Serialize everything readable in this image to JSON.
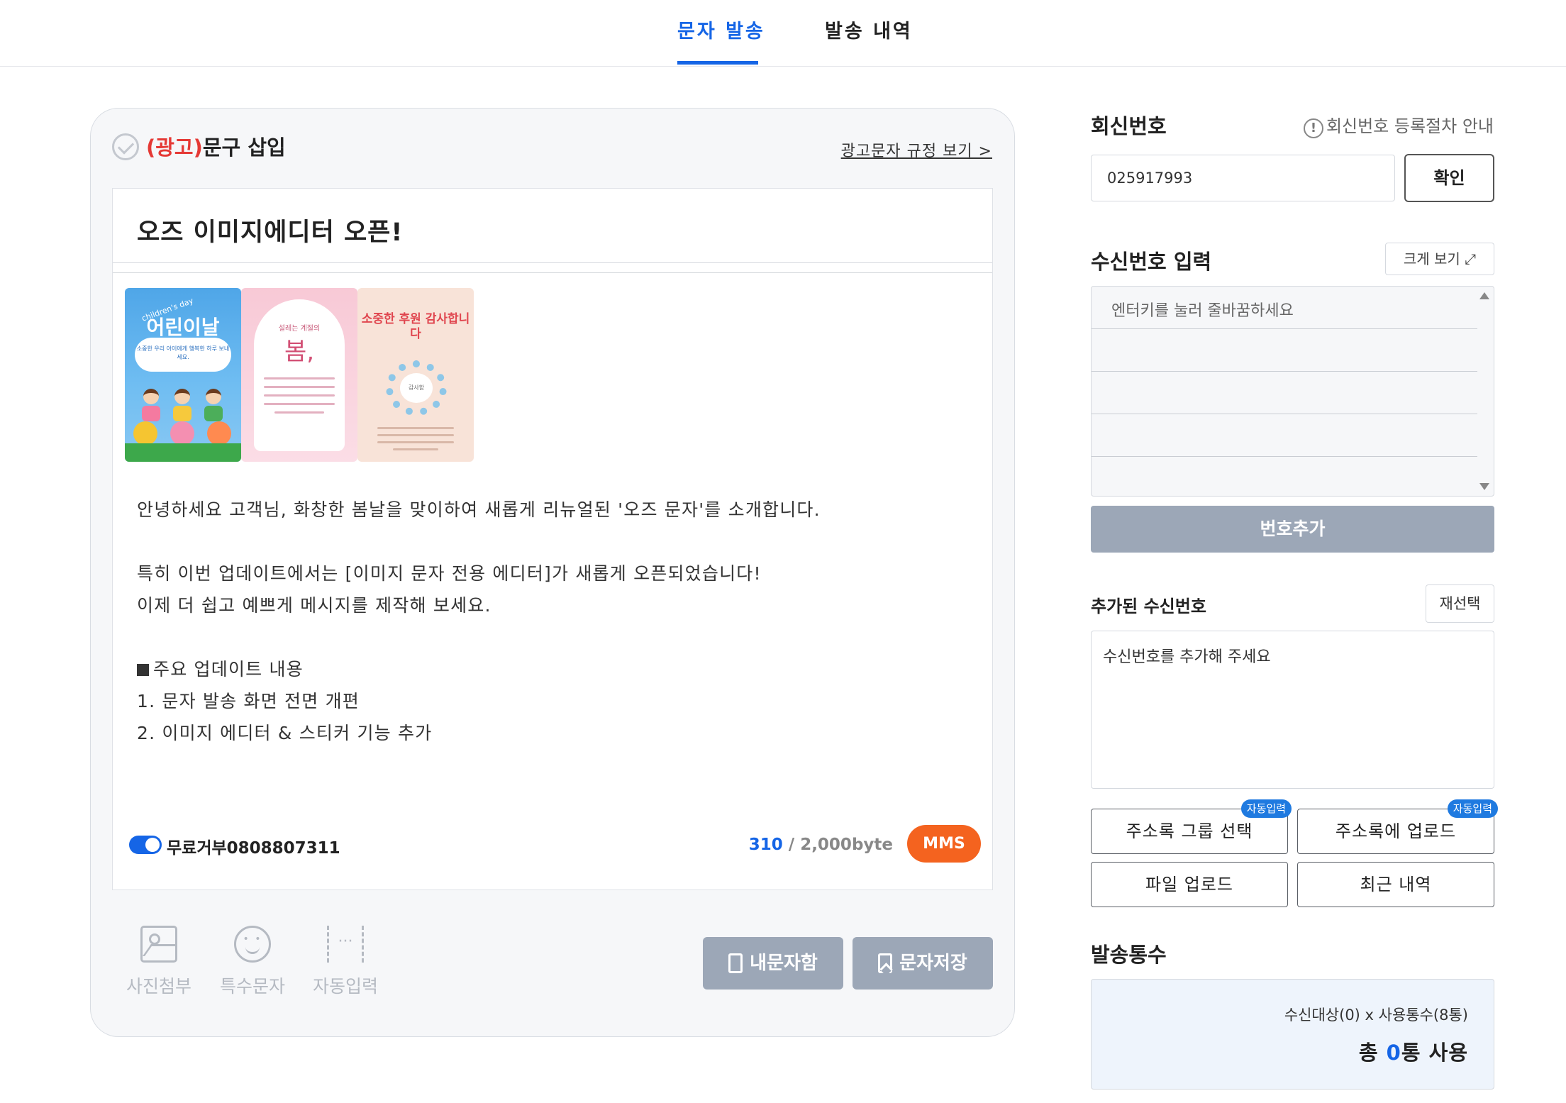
{
  "tabs": [
    {
      "label": "문자 발송",
      "active": true
    },
    {
      "label": "발송 내역",
      "active": false
    }
  ],
  "editor": {
    "ad_prefix": "(광고)",
    "ad_title_suffix": "문구 삽입",
    "ad_rule_link": "광고문자 규정 보기 >",
    "subject": "오즈 이미지에디터 오픈!",
    "images": [
      {
        "title": "어린이날",
        "subtitle": "children's day",
        "caption": "소중한 우리 아이에게 행복한 하루 보내세요."
      },
      {
        "small": "설레는 계절의",
        "big": "봄,"
      },
      {
        "title": "소중한 후원 감사합니다",
        "center": "감사함"
      }
    ],
    "body_lines": [
      "안녕하세요 고객님, 화창한 봄날을 맞이하여 새롭게 리뉴얼된 '오즈 문자'를 소개합니다.",
      "",
      "특히 이번 업데이트에서는 [이미지 문자 전용 에디터]가 새롭게 오픈되었습니다!",
      "이제 더 쉽고 예쁘게 메시지를 제작해 보세요.",
      "",
      "주요 업데이트 내용",
      "1. 문자 발송 화면 전면 개편",
      "2. 이미지 에디터 & 스티커 기능 추가"
    ],
    "optout_label": "무료거부0808807311",
    "optout_enabled": true,
    "byte_count": "310",
    "byte_limit": "/ 2,000byte",
    "message_type": "MMS"
  },
  "tools": [
    {
      "label": "사진첨부",
      "icon": "photo-icon"
    },
    {
      "label": "특수문자",
      "icon": "smile-icon"
    },
    {
      "label": "자동입력",
      "icon": "bracket-icon"
    }
  ],
  "actions": {
    "my_messages": "내문자함",
    "save_message": "문자저장"
  },
  "reply": {
    "title": "회신번호",
    "help": "회신번호 등록절차 안내",
    "value": "025917993",
    "confirm": "확인"
  },
  "recipients": {
    "title": "수신번호 입력",
    "expand": "크게 보기",
    "placeholder": "엔터키를 눌러 줄바꿈하세요",
    "add_button": "번호추가",
    "added_title": "추가된 수신번호",
    "reselect": "재선택",
    "added_placeholder": "수신번호를 추가해 주세요",
    "buttons": [
      {
        "label": "주소록 그룹 선택",
        "badge": "자동입력"
      },
      {
        "label": "주소록에 업로드",
        "badge": "자동입력"
      },
      {
        "label": "파일 업로드"
      },
      {
        "label": "최근 내역"
      }
    ]
  },
  "stats": {
    "title": "발송통수",
    "formula": "수신대상(0) x 사용통수(8통)",
    "total_prefix": "총 ",
    "total_value": "0",
    "total_suffix": "통 사용"
  },
  "colors": {
    "accent": "#1565e6",
    "ad_red": "#e53935",
    "mms_orange": "#f4631f",
    "disabled_button": "#9ca7b7"
  }
}
